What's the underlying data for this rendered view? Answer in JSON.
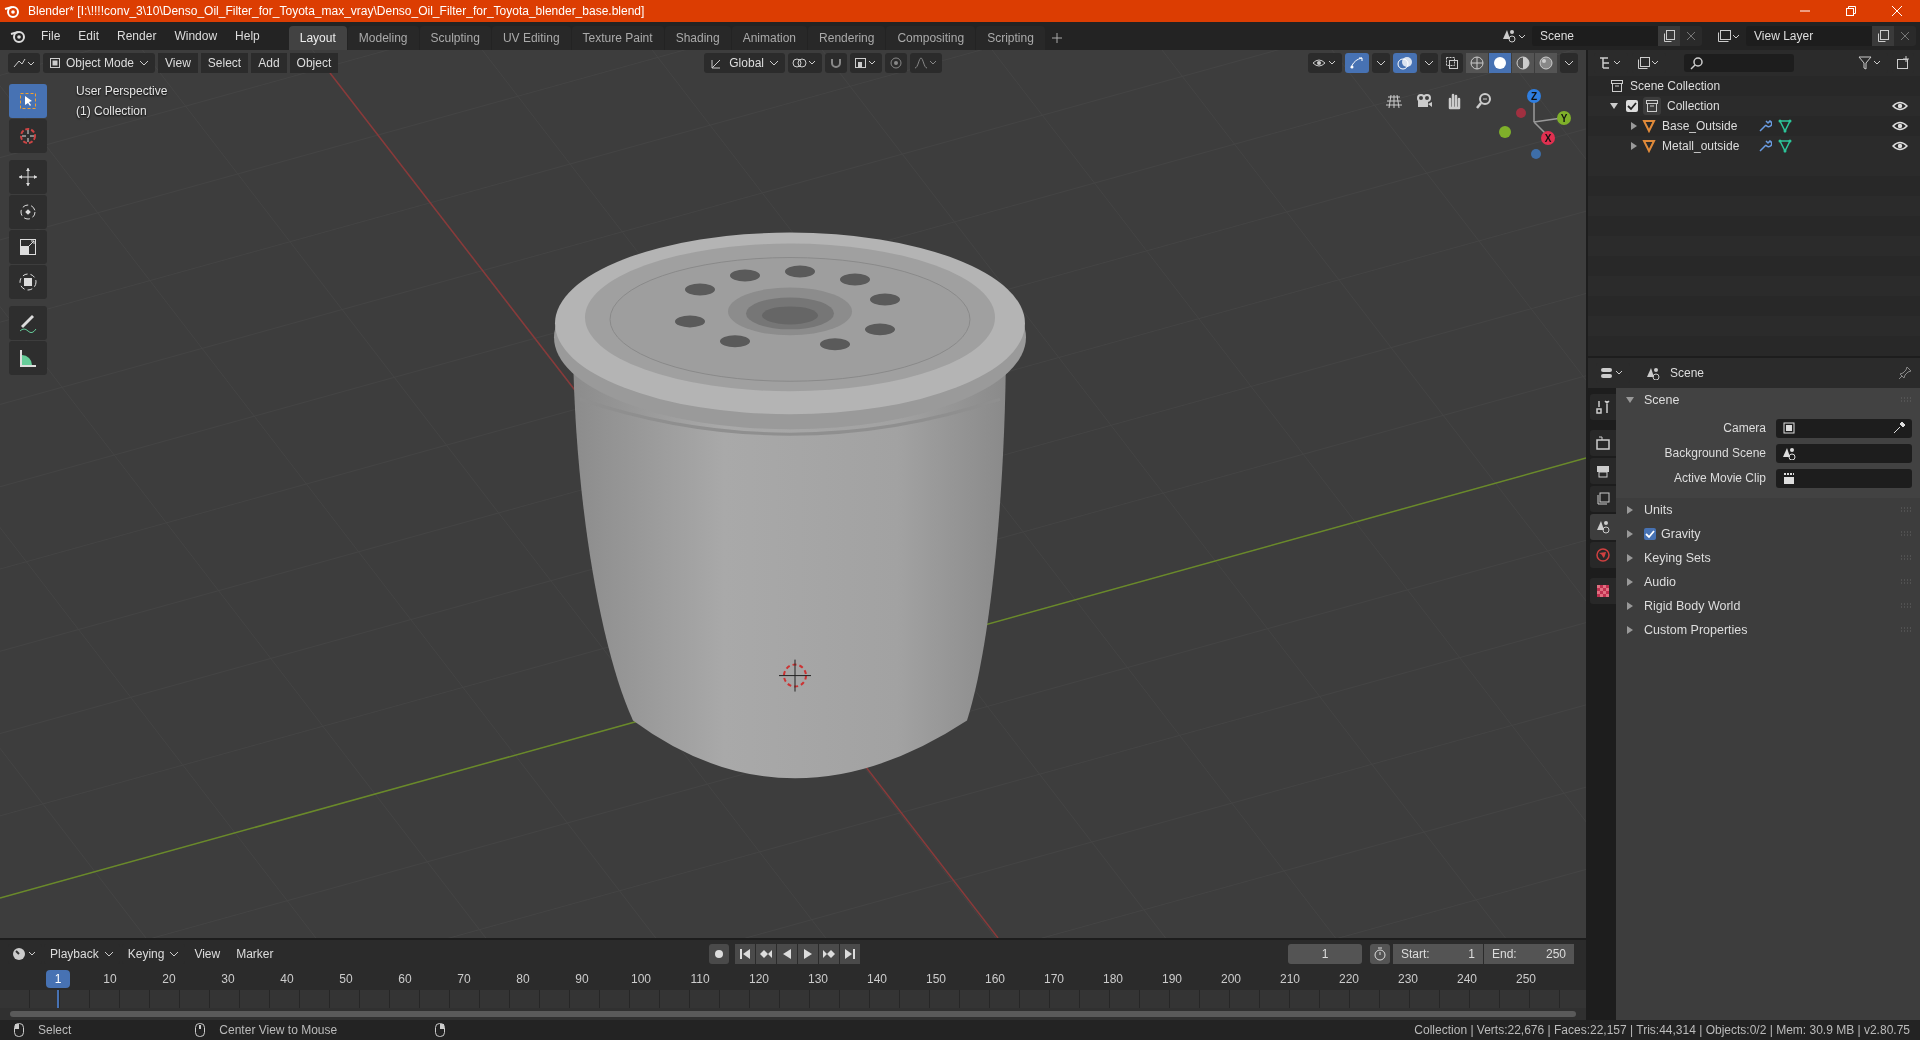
{
  "window": {
    "title": "Blender* [I:\\!!!!conv_3\\10\\Denso_Oil_Filter_for_Toyota_max_vray\\Denso_Oil_Filter_for_Toyota_blender_base.blend]"
  },
  "menu": [
    "File",
    "Edit",
    "Render",
    "Window",
    "Help"
  ],
  "workspace_tabs": [
    {
      "label": "Layout",
      "selected": true
    },
    {
      "label": "Modeling",
      "selected": false
    },
    {
      "label": "Sculpting",
      "selected": false
    },
    {
      "label": "UV Editing",
      "selected": false
    },
    {
      "label": "Texture Paint",
      "selected": false
    },
    {
      "label": "Shading",
      "selected": false
    },
    {
      "label": "Animation",
      "selected": false
    },
    {
      "label": "Rendering",
      "selected": false
    },
    {
      "label": "Compositing",
      "selected": false
    },
    {
      "label": "Scripting",
      "selected": false
    }
  ],
  "scene_field": {
    "value": "Scene"
  },
  "view_layer_field": {
    "value": "View Layer"
  },
  "viewport": {
    "mode": "Object Mode",
    "menus": [
      "View",
      "Select",
      "Add",
      "Object"
    ],
    "orientation": "Global",
    "gizmos": {
      "on": true
    },
    "overlays": {
      "on": true
    },
    "xray": {
      "on": false
    },
    "shading": [
      {
        "kind": "wireframe",
        "selected": false
      },
      {
        "kind": "solid",
        "selected": true
      },
      {
        "kind": "material",
        "selected": false
      },
      {
        "kind": "rendered",
        "selected": false
      }
    ],
    "info": [
      "User Perspective",
      "(1) Collection"
    ],
    "tools": [
      {
        "kind": "select",
        "selected": true
      },
      {
        "kind": "cursor",
        "selected": false
      },
      {
        "kind": "move",
        "selected": false
      },
      {
        "kind": "rotate",
        "selected": false
      },
      {
        "kind": "scale",
        "selected": false
      },
      {
        "kind": "transform",
        "selected": false
      },
      {
        "kind": "annotate",
        "selected": false
      },
      {
        "kind": "measure",
        "selected": false
      }
    ],
    "axes": [
      "Z",
      "Y",
      "X"
    ]
  },
  "outliner": {
    "root": {
      "label": "Scene Collection",
      "children": [
        {
          "label": "Collection",
          "checked": true,
          "expanded": true,
          "children": [
            {
              "label": "Base_Outside",
              "expanded": false
            },
            {
              "label": "Metall_outside",
              "expanded": false
            }
          ]
        }
      ]
    }
  },
  "properties": {
    "context": "Scene",
    "tabs": [
      {
        "kind": "tool",
        "selected": false
      },
      {
        "kind": "render",
        "selected": false
      },
      {
        "kind": "output",
        "selected": false
      },
      {
        "kind": "view-layer",
        "selected": false
      },
      {
        "kind": "scene",
        "selected": true
      },
      {
        "kind": "world",
        "selected": false
      },
      {
        "kind": "texture",
        "selected": false
      }
    ],
    "panels": [
      {
        "label": "Scene",
        "expanded": true,
        "fields": [
          {
            "label": "Camera",
            "kind": "camera"
          },
          {
            "label": "Background Scene",
            "kind": "scene"
          },
          {
            "label": "Active Movie Clip",
            "kind": "clip"
          }
        ]
      },
      {
        "label": "Units",
        "expanded": false
      },
      {
        "label": "Gravity",
        "expanded": false,
        "checked": true
      },
      {
        "label": "Keying Sets",
        "expanded": false
      },
      {
        "label": "Audio",
        "expanded": false
      },
      {
        "label": "Rigid Body World",
        "expanded": false
      },
      {
        "label": "Custom Properties",
        "expanded": false
      }
    ]
  },
  "timeline": {
    "menus": [
      {
        "label": "Playback",
        "kind": "dropdown"
      },
      {
        "label": "Keying",
        "kind": "dropdown"
      },
      {
        "label": "View",
        "kind": "menu"
      },
      {
        "label": "Marker",
        "kind": "menu"
      }
    ],
    "current_frame": "1",
    "start": {
      "label": "Start:",
      "value": "1"
    },
    "end": {
      "label": "End:",
      "value": "250"
    },
    "playhead": "1",
    "ruler": [
      "10",
      "20",
      "30",
      "40",
      "50",
      "60",
      "70",
      "80",
      "90",
      "100",
      "110",
      "120",
      "130",
      "140",
      "150",
      "160",
      "170",
      "180",
      "190",
      "200",
      "210",
      "220",
      "230",
      "240",
      "250"
    ]
  },
  "status_bar": {
    "hints": [
      "Select",
      "Center View to Mouse"
    ],
    "stats": "Collection | Verts:22,676 | Faces:22,157 | Tris:44,314 | Objects:0/2 | Mem: 30.9 MB | v2.80.75"
  }
}
